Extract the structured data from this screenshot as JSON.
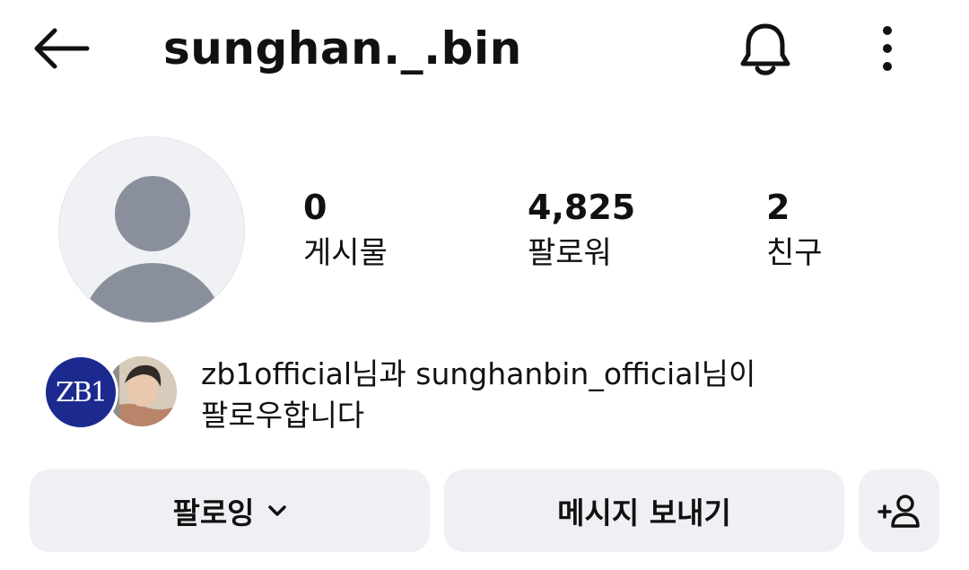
{
  "header": {
    "back_icon": "arrow-left-icon",
    "username": "sunghan._.bin",
    "bell_icon": "bell-icon",
    "more_icon": "vertical-dots-icon"
  },
  "profile": {
    "avatar_icon": "default-person-avatar",
    "stats": [
      {
        "value": "0",
        "label": "게시물"
      },
      {
        "value": "4,825",
        "label": "팔로워"
      },
      {
        "value": "2",
        "label": "친구"
      }
    ]
  },
  "mutual": {
    "avatar1_text": "ZB1",
    "line1": "zb1official님과 sunghanbin_official님이",
    "line2": "팔로우합니다"
  },
  "actions": {
    "following_label": "팔로잉",
    "following_icon": "chevron-down-icon",
    "message_label": "메시지 보내기",
    "add_person_icon": "add-person-icon"
  },
  "colors": {
    "button_bg": "#eff0f3",
    "avatar_bg": "#eff1f5",
    "avatar_silhouette": "#8a909b",
    "zb1_blue": "#1c2a8f"
  }
}
